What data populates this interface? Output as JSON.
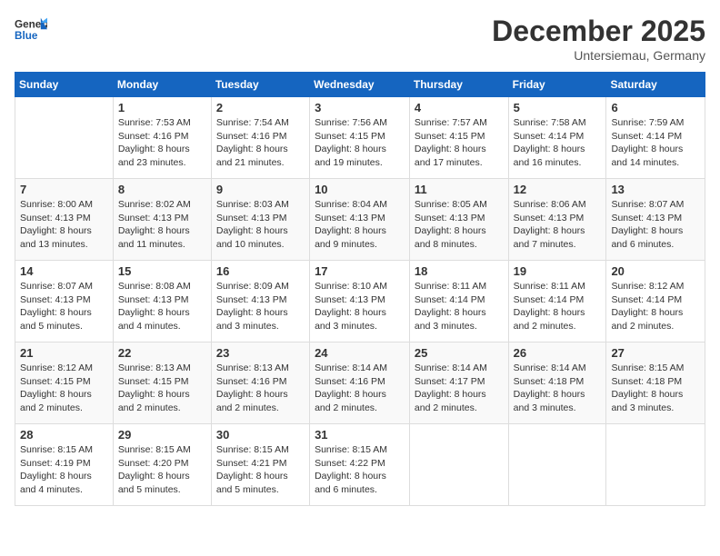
{
  "header": {
    "logo_general": "General",
    "logo_blue": "Blue",
    "month_year": "December 2025",
    "location": "Untersiemau, Germany"
  },
  "days_of_week": [
    "Sunday",
    "Monday",
    "Tuesday",
    "Wednesday",
    "Thursday",
    "Friday",
    "Saturday"
  ],
  "weeks": [
    [
      {
        "day": "",
        "info": ""
      },
      {
        "day": "1",
        "info": "Sunrise: 7:53 AM\nSunset: 4:16 PM\nDaylight: 8 hours\nand 23 minutes."
      },
      {
        "day": "2",
        "info": "Sunrise: 7:54 AM\nSunset: 4:16 PM\nDaylight: 8 hours\nand 21 minutes."
      },
      {
        "day": "3",
        "info": "Sunrise: 7:56 AM\nSunset: 4:15 PM\nDaylight: 8 hours\nand 19 minutes."
      },
      {
        "day": "4",
        "info": "Sunrise: 7:57 AM\nSunset: 4:15 PM\nDaylight: 8 hours\nand 17 minutes."
      },
      {
        "day": "5",
        "info": "Sunrise: 7:58 AM\nSunset: 4:14 PM\nDaylight: 8 hours\nand 16 minutes."
      },
      {
        "day": "6",
        "info": "Sunrise: 7:59 AM\nSunset: 4:14 PM\nDaylight: 8 hours\nand 14 minutes."
      }
    ],
    [
      {
        "day": "7",
        "info": ""
      },
      {
        "day": "8",
        "info": "Sunrise: 8:02 AM\nSunset: 4:13 PM\nDaylight: 8 hours\nand 11 minutes."
      },
      {
        "day": "9",
        "info": "Sunrise: 8:03 AM\nSunset: 4:13 PM\nDaylight: 8 hours\nand 10 minutes."
      },
      {
        "day": "10",
        "info": "Sunrise: 8:04 AM\nSunset: 4:13 PM\nDaylight: 8 hours\nand 9 minutes."
      },
      {
        "day": "11",
        "info": "Sunrise: 8:05 AM\nSunset: 4:13 PM\nDaylight: 8 hours\nand 8 minutes."
      },
      {
        "day": "12",
        "info": "Sunrise: 8:06 AM\nSunset: 4:13 PM\nDaylight: 8 hours\nand 7 minutes."
      },
      {
        "day": "13",
        "info": "Sunrise: 8:07 AM\nSunset: 4:13 PM\nDaylight: 8 hours\nand 6 minutes."
      }
    ],
    [
      {
        "day": "14",
        "info": ""
      },
      {
        "day": "15",
        "info": "Sunrise: 8:08 AM\nSunset: 4:13 PM\nDaylight: 8 hours\nand 4 minutes."
      },
      {
        "day": "16",
        "info": "Sunrise: 8:09 AM\nSunset: 4:13 PM\nDaylight: 8 hours\nand 3 minutes."
      },
      {
        "day": "17",
        "info": "Sunrise: 8:10 AM\nSunset: 4:13 PM\nDaylight: 8 hours\nand 3 minutes."
      },
      {
        "day": "18",
        "info": "Sunrise: 8:11 AM\nSunset: 4:14 PM\nDaylight: 8 hours\nand 3 minutes."
      },
      {
        "day": "19",
        "info": "Sunrise: 8:11 AM\nSunset: 4:14 PM\nDaylight: 8 hours\nand 2 minutes."
      },
      {
        "day": "20",
        "info": "Sunrise: 8:12 AM\nSunset: 4:14 PM\nDaylight: 8 hours\nand 2 minutes."
      }
    ],
    [
      {
        "day": "21",
        "info": "Sunrise: 8:12 AM\nSunset: 4:15 PM\nDaylight: 8 hours\nand 2 minutes."
      },
      {
        "day": "22",
        "info": "Sunrise: 8:13 AM\nSunset: 4:15 PM\nDaylight: 8 hours\nand 2 minutes."
      },
      {
        "day": "23",
        "info": "Sunrise: 8:13 AM\nSunset: 4:16 PM\nDaylight: 8 hours\nand 2 minutes."
      },
      {
        "day": "24",
        "info": "Sunrise: 8:14 AM\nSunset: 4:16 PM\nDaylight: 8 hours\nand 2 minutes."
      },
      {
        "day": "25",
        "info": "Sunrise: 8:14 AM\nSunset: 4:17 PM\nDaylight: 8 hours\nand 2 minutes."
      },
      {
        "day": "26",
        "info": "Sunrise: 8:14 AM\nSunset: 4:18 PM\nDaylight: 8 hours\nand 3 minutes."
      },
      {
        "day": "27",
        "info": "Sunrise: 8:15 AM\nSunset: 4:18 PM\nDaylight: 8 hours\nand 3 minutes."
      }
    ],
    [
      {
        "day": "28",
        "info": "Sunrise: 8:15 AM\nSunset: 4:19 PM\nDaylight: 8 hours\nand 4 minutes."
      },
      {
        "day": "29",
        "info": "Sunrise: 8:15 AM\nSunset: 4:20 PM\nDaylight: 8 hours\nand 5 minutes."
      },
      {
        "day": "30",
        "info": "Sunrise: 8:15 AM\nSunset: 4:21 PM\nDaylight: 8 hours\nand 5 minutes."
      },
      {
        "day": "31",
        "info": "Sunrise: 8:15 AM\nSunset: 4:22 PM\nDaylight: 8 hours\nand 6 minutes."
      },
      {
        "day": "",
        "info": ""
      },
      {
        "day": "",
        "info": ""
      },
      {
        "day": "",
        "info": ""
      }
    ]
  ],
  "week7_sunday": "Sunrise: 8:00 AM\nSunset: 4:13 PM\nDaylight: 8 hours\nand 13 minutes.",
  "week14_sunday": "Sunrise: 8:07 AM\nSunset: 4:13 PM\nDaylight: 8 hours\nand 5 minutes."
}
